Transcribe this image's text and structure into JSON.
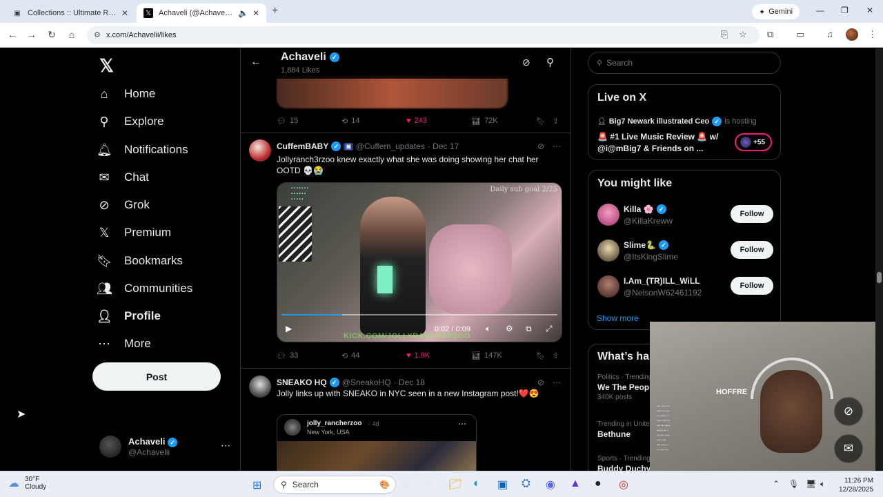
{
  "browser": {
    "tabs": [
      {
        "title": "Collections :: Ultimate Rap Leag",
        "active": false
      },
      {
        "title": "Achaveli (@Achavelii) / X",
        "active": true
      }
    ],
    "gemini_label": "Gemini",
    "url": "x.com/Achavelii/likes"
  },
  "nav": {
    "items": [
      {
        "label": "Home",
        "icon": "home-icon"
      },
      {
        "label": "Explore",
        "icon": "search-icon"
      },
      {
        "label": "Notifications",
        "icon": "bell-icon"
      },
      {
        "label": "Chat",
        "icon": "mail-icon"
      },
      {
        "label": "Grok",
        "icon": "grok-icon"
      },
      {
        "label": "Premium",
        "icon": "x-icon"
      },
      {
        "label": "Bookmarks",
        "icon": "bookmark-icon"
      },
      {
        "label": "Communities",
        "icon": "communities-icon"
      },
      {
        "label": "Profile",
        "icon": "person-icon"
      },
      {
        "label": "More",
        "icon": "more-icon"
      }
    ],
    "post_label": "Post",
    "account": {
      "name": "Achaveli",
      "handle": "@Achavelii"
    }
  },
  "header": {
    "name": "Achaveli",
    "subtitle": "1,884 Likes"
  },
  "tweets": {
    "prev_stats": {
      "replies": "15",
      "reposts": "14",
      "likes": "243",
      "views": "72K"
    },
    "t1": {
      "name": "CuffemBABY",
      "handle": "@Cuffem_updates",
      "date": "· Dec 17",
      "text": "Jollyranch3rzoo knew exactly what she was doing showing her chat her OOTD 💀😭",
      "video": {
        "goal_text": "Daily sub goal 2/25",
        "time": "0:02 / 0:09",
        "watermark": "KICK.COM/JOLLYRANCHERZOO",
        "progress": 0.22
      },
      "stats": {
        "replies": "33",
        "reposts": "44",
        "likes": "1.9K",
        "views": "147K"
      }
    },
    "t2": {
      "name": "SNEAKO HQ",
      "handle": "@SneakoHQ",
      "date": "· Dec 18",
      "text": "Jolly links up with SNEAKO in NYC seen in a new Instagram post!❤️😍",
      "embed": {
        "user": "jolly_rancherzoo",
        "time": "· 4d",
        "location": "New York, USA"
      }
    }
  },
  "sidebar": {
    "search_placeholder": "Search",
    "live": {
      "title": "Live on X",
      "host_name": "Big7 Newark illustrated Ceo",
      "host_suffix": "is hosting",
      "space_title": "🚨 #1 Live Music Review 🚨 w/ @i@mBig7 & Friends on ...",
      "listeners": "+55"
    },
    "might_like": {
      "title": "You might like",
      "users": [
        {
          "name": "Killa 🌸",
          "handle": "@KillaKreww",
          "button": "Follow"
        },
        {
          "name": "Slime🐍",
          "handle": "@ItsKingSlime",
          "button": "Follow"
        },
        {
          "name": "I.Am_(TR)ILL_WiLL",
          "handle": "@NelsonW62461192",
          "button": "Follow"
        }
      ],
      "show_more": "Show more"
    },
    "happening": {
      "title": "What’s happening",
      "trends": [
        {
          "context": "Politics · Trending",
          "name": "We The People",
          "posts": "340K posts"
        },
        {
          "context": "Trending in United",
          "name": "Bethune",
          "posts": ""
        },
        {
          "context": "Sports · Trending",
          "name": "Buddy Duchy",
          "posts": ""
        }
      ]
    }
  },
  "webcam": {
    "poster_text": "HOFFRE"
  },
  "taskbar": {
    "temp": "30°F",
    "condition": "Cloudy",
    "search_label": "Search",
    "time": "11:26 PM",
    "date": "12/28/2025"
  }
}
